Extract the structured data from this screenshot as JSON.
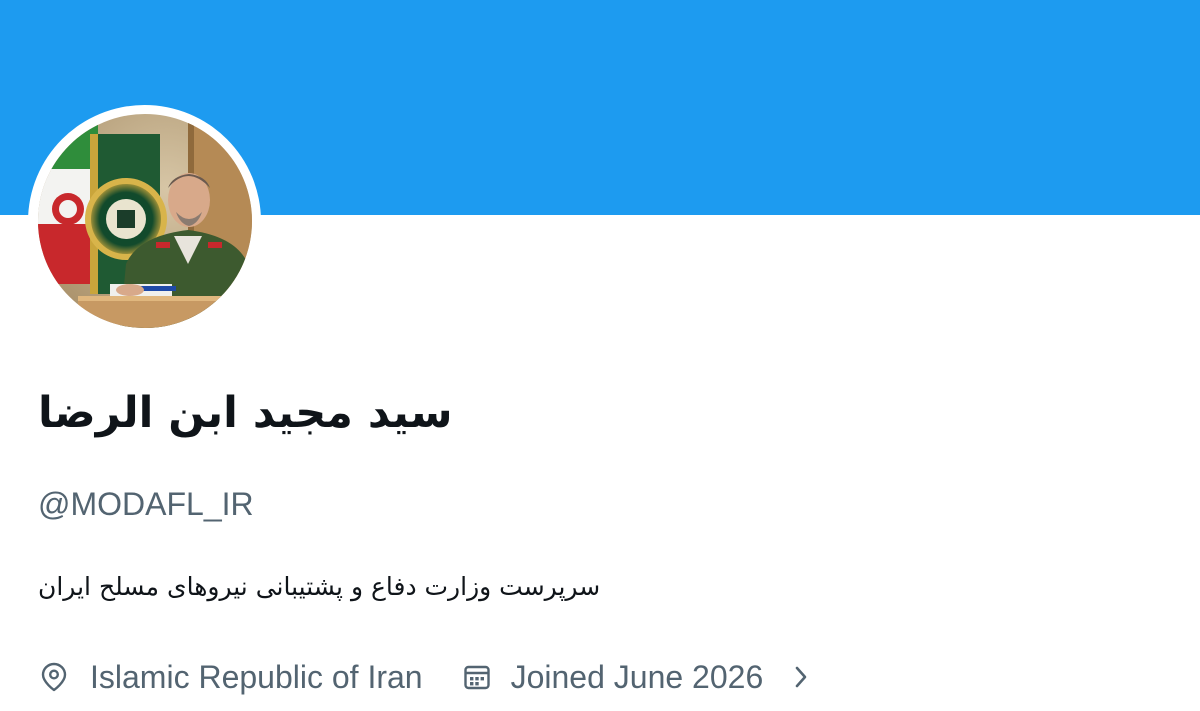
{
  "profile": {
    "display_name": "سید مجید ابن الرضا",
    "handle": "@MODAFL_IR",
    "bio": "سرپرست وزارت دفاع و پشتیبانی نیروهای مسلح ایران",
    "location": "Islamic Republic of Iran",
    "joined": "Joined June 2026"
  },
  "icons": {
    "location": "map-pin-icon",
    "joined": "calendar-icon",
    "more": "chevron-right-icon"
  },
  "colors": {
    "banner": "#1d9bf0",
    "primary_text": "#0f1419",
    "secondary_text": "#536471",
    "background": "#ffffff"
  }
}
